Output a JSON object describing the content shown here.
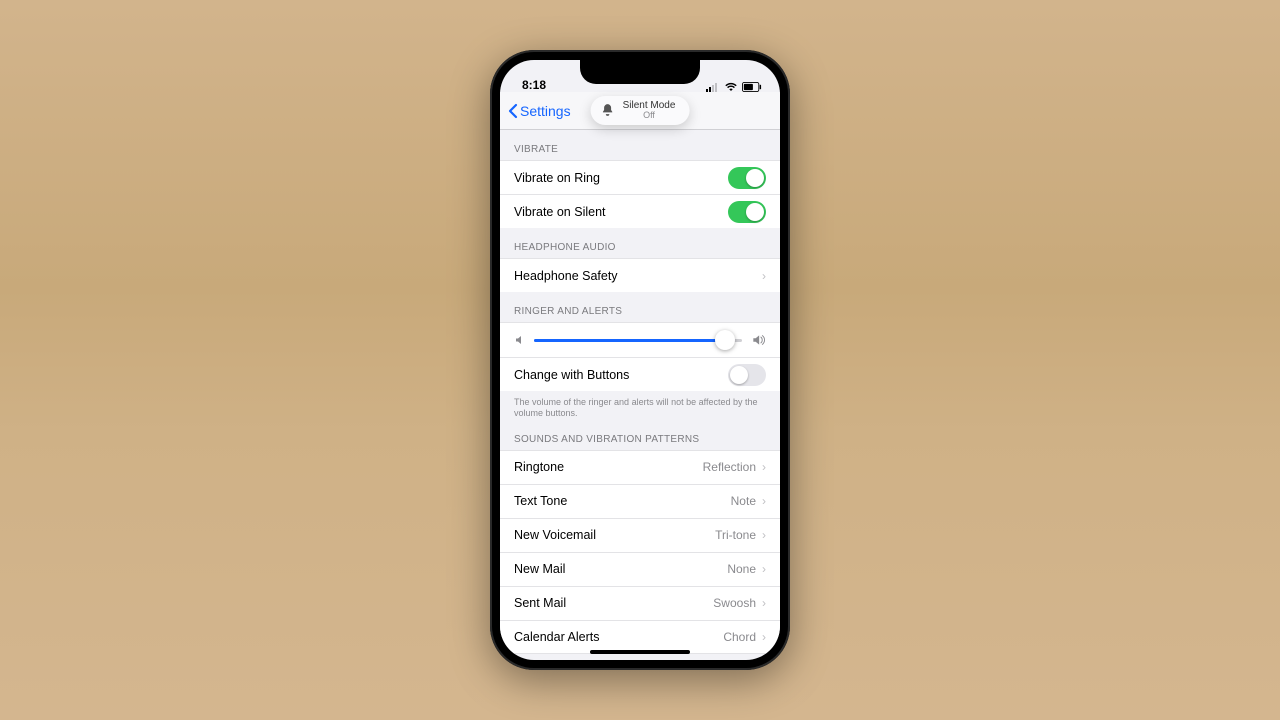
{
  "status": {
    "time": "8:18"
  },
  "nav": {
    "back": "Settings"
  },
  "pill": {
    "title": "Silent Mode",
    "state": "Off"
  },
  "sections": {
    "vibrate_header": "VIBRATE",
    "vibrate_ring": "Vibrate on Ring",
    "vibrate_silent": "Vibrate on Silent",
    "headphone_header": "HEADPHONE AUDIO",
    "headphone_safety": "Headphone Safety",
    "ringer_header": "RINGER AND ALERTS",
    "change_buttons": "Change with Buttons",
    "ringer_footer": "The volume of the ringer and alerts will not be affected by the volume buttons.",
    "sounds_header": "SOUNDS AND VIBRATION PATTERNS",
    "ringtone_l": "Ringtone",
    "ringtone_v": "Reflection",
    "texttone_l": "Text Tone",
    "texttone_v": "Note",
    "voicemail_l": "New Voicemail",
    "voicemail_v": "Tri-tone",
    "newmail_l": "New Mail",
    "newmail_v": "None",
    "sentmail_l": "Sent Mail",
    "sentmail_v": "Swoosh",
    "calendar_l": "Calendar Alerts",
    "calendar_v": "Chord"
  },
  "toggles": {
    "vibrate_ring": true,
    "vibrate_silent": true,
    "change_buttons": false
  },
  "slider": {
    "percent": 92
  }
}
